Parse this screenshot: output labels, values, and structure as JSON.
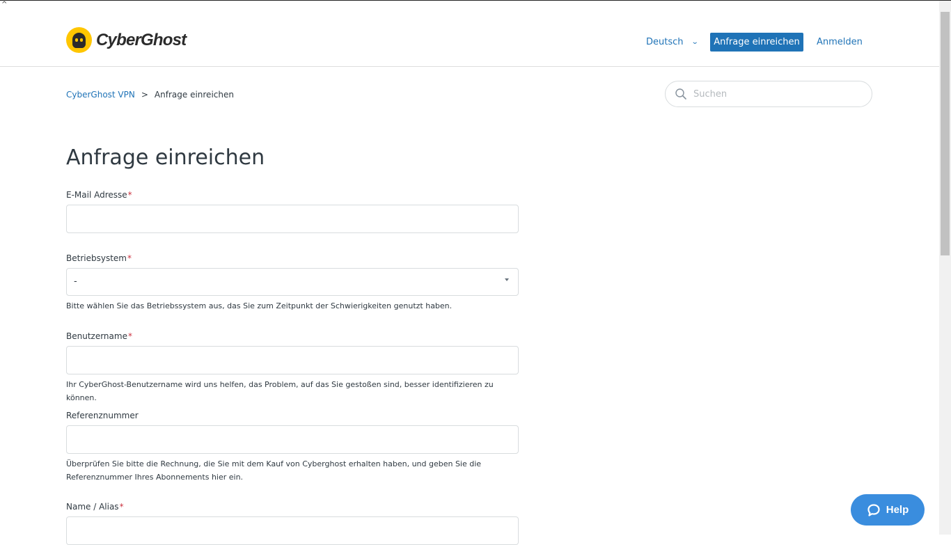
{
  "header": {
    "brand": "CyberGhost",
    "language": "Deutsch",
    "submit_request": "Anfrage einreichen",
    "sign_in": "Anmelden"
  },
  "breadcrumb": {
    "home": "CyberGhost VPN",
    "separator": ">",
    "current": "Anfrage einreichen"
  },
  "search": {
    "placeholder": "Suchen"
  },
  "page": {
    "title": "Anfrage einreichen",
    "fields": {
      "email": {
        "label": "E-Mail Adresse",
        "required": "*",
        "value": ""
      },
      "os": {
        "label": "Betriebsystem",
        "required": "*",
        "selected": "-",
        "hint": "Bitte wählen Sie das Betriebssystem aus, das Sie zum Zeitpunkt der Schwierigkeiten genutzt haben."
      },
      "username": {
        "label": "Benutzername",
        "required": "*",
        "value": "",
        "hint": "Ihr CyberGhost-Benutzername wird uns helfen, das Problem, auf das Sie gestoßen sind, besser identifizieren zu können."
      },
      "reference": {
        "label": "Referenznummer",
        "value": "",
        "hint": "Überprüfen Sie bitte die Rechnung, die Sie mit dem Kauf von Cyberghost erhalten haben, und geben Sie die Referenznummer Ihres Abonnements hier ein."
      },
      "name": {
        "label": "Name / Alias",
        "required": "*",
        "value": ""
      }
    }
  },
  "help": {
    "label": "Help"
  },
  "misc": {
    "corner_mark": "^"
  },
  "colors": {
    "accent": "#1f73b7",
    "help": "#3a8dde",
    "brand_yellow": "#ffc600",
    "required": "#cc3340"
  }
}
